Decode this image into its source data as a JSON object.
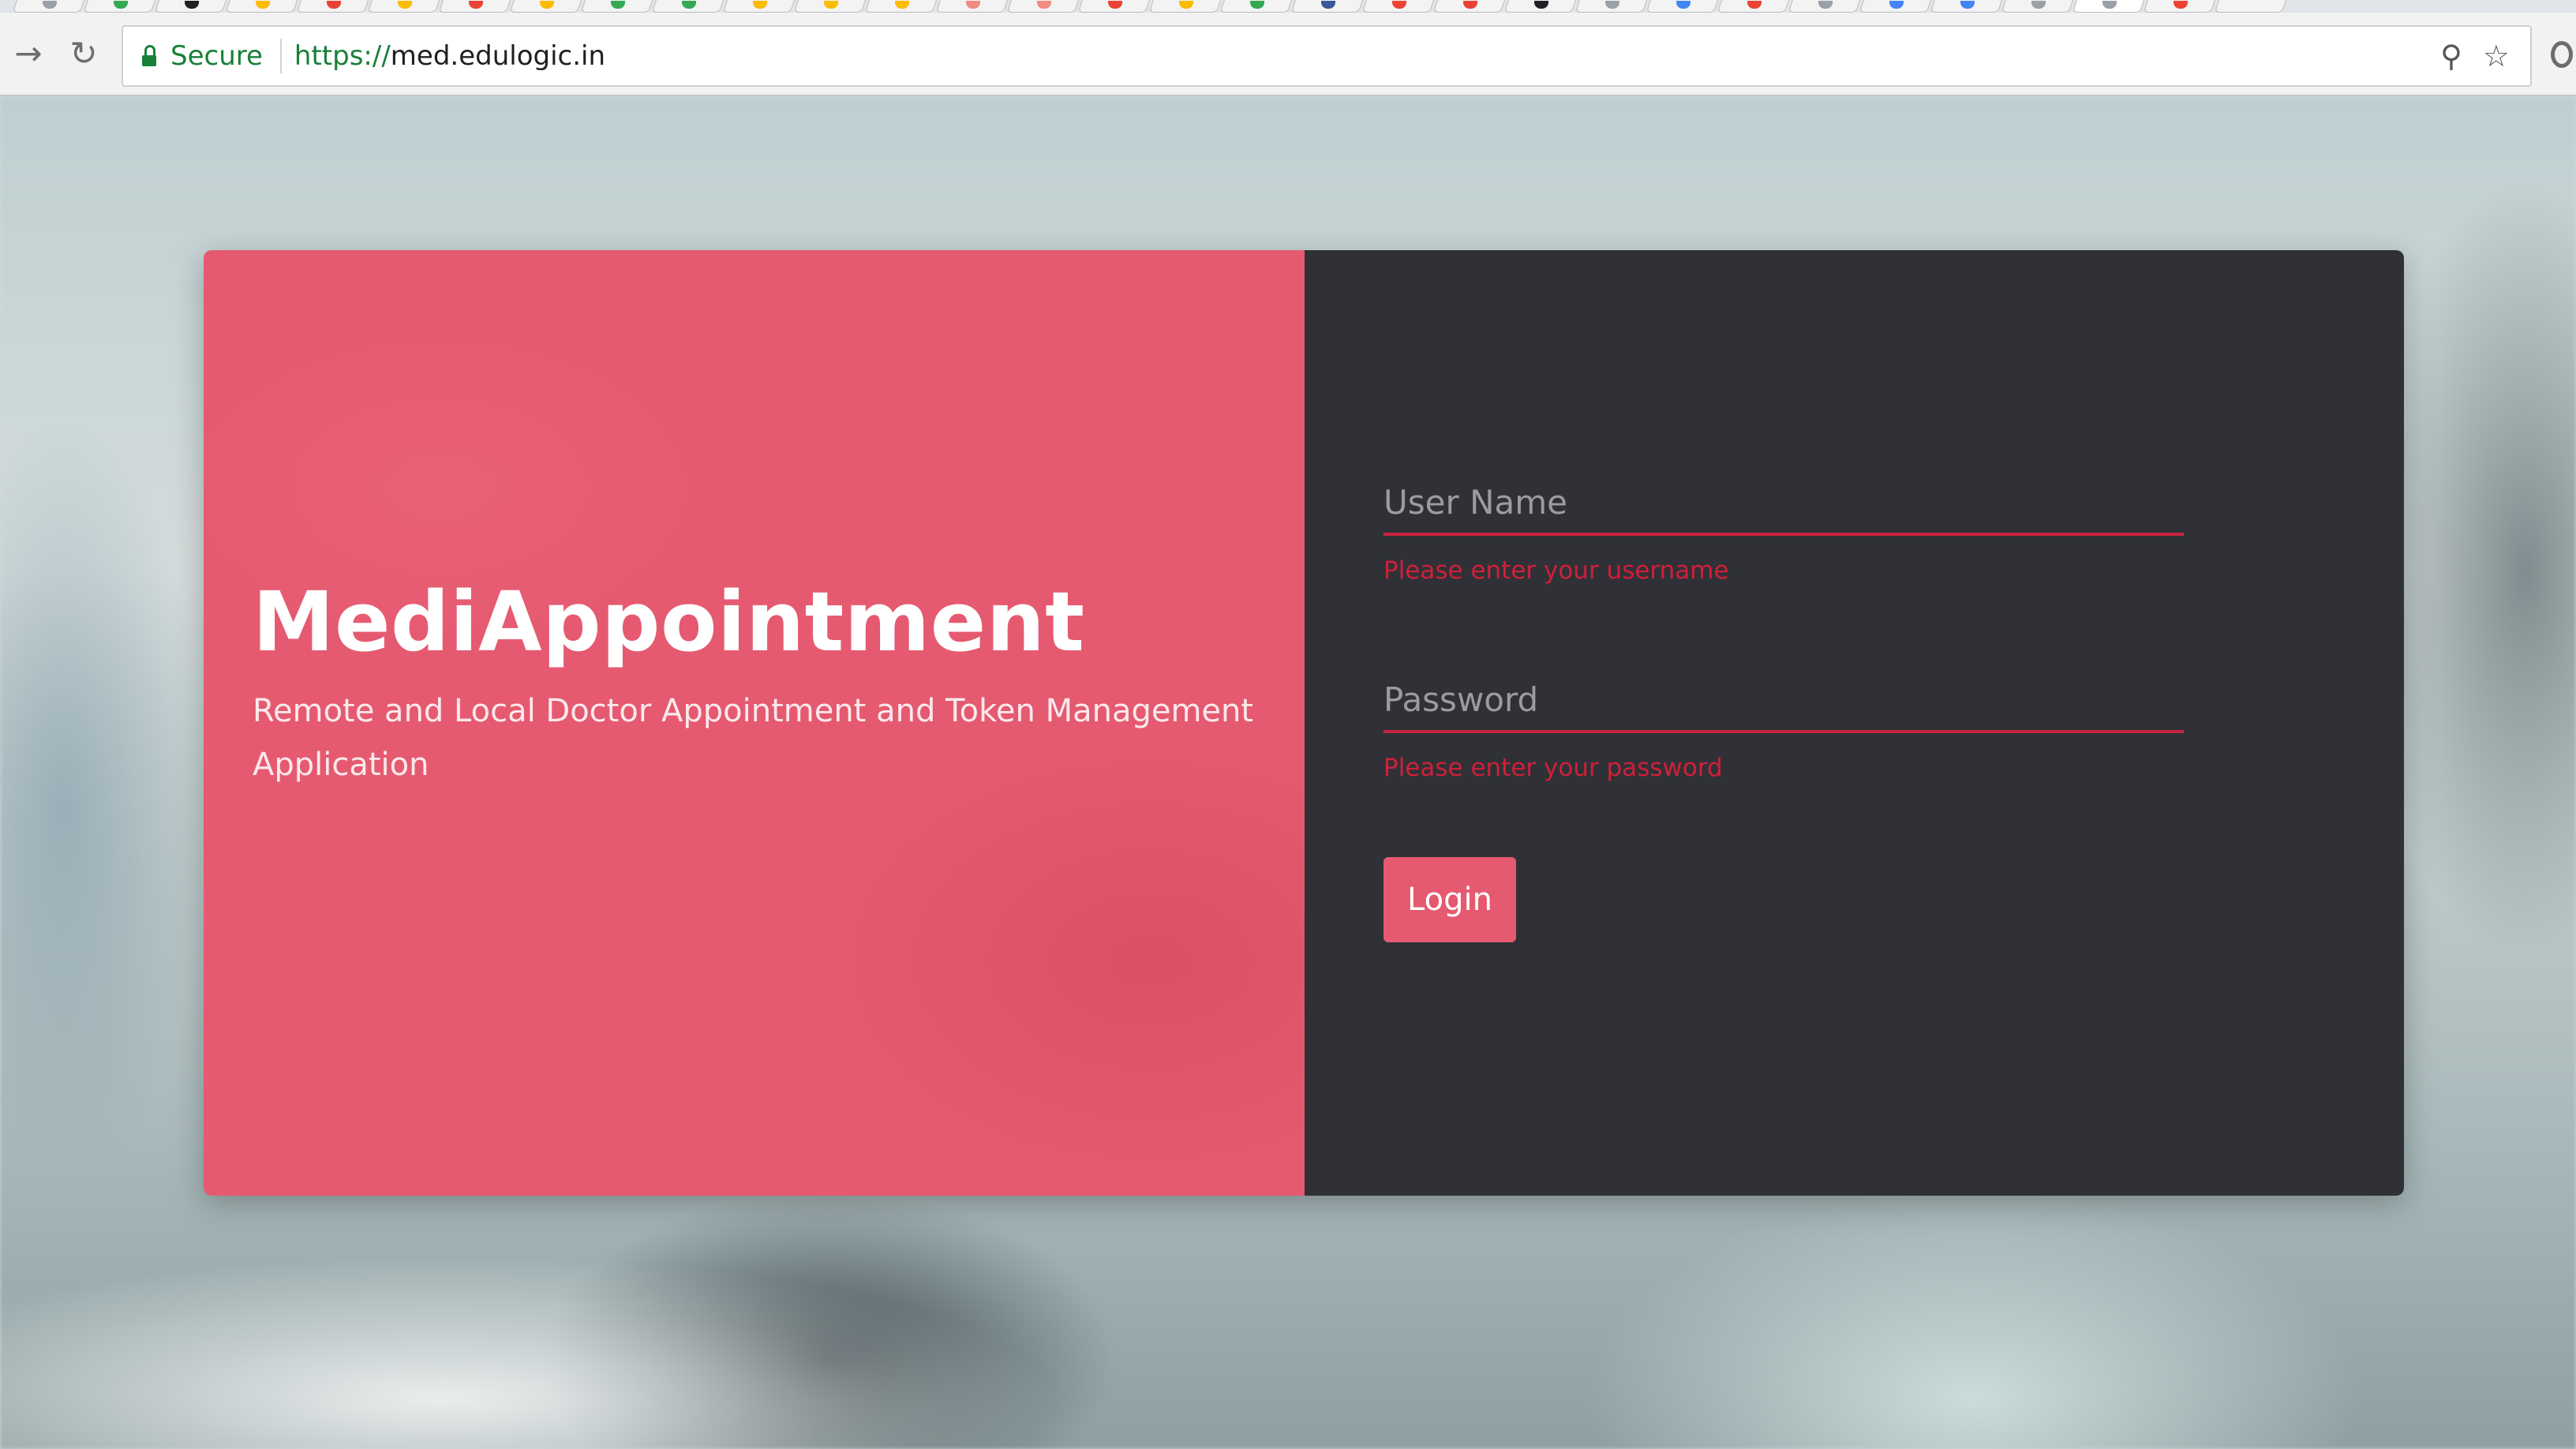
{
  "browser": {
    "secure_label": "Secure",
    "url_scheme": "https://",
    "url_host": "med.edulogic.in",
    "icons": {
      "back": "back-arrow-icon",
      "reload": "reload-icon",
      "lock": "lock-icon",
      "key": "key-icon",
      "bookmark": "star-icon",
      "extension": "extension-icon"
    }
  },
  "brand": {
    "title": "MediAppointment",
    "subtitle": "Remote and Local Doctor Appointment and Token Management Application"
  },
  "login_form": {
    "username": {
      "placeholder": "User Name",
      "value": "",
      "error": "Please enter your username"
    },
    "password": {
      "placeholder": "Password",
      "value": "",
      "error": "Please enter your password"
    },
    "submit_label": "Login"
  },
  "colors": {
    "brand_panel": "#e55a70",
    "form_panel": "#303136",
    "error": "#d01f3a",
    "button": "#e55a70",
    "secure_green": "#188038"
  }
}
